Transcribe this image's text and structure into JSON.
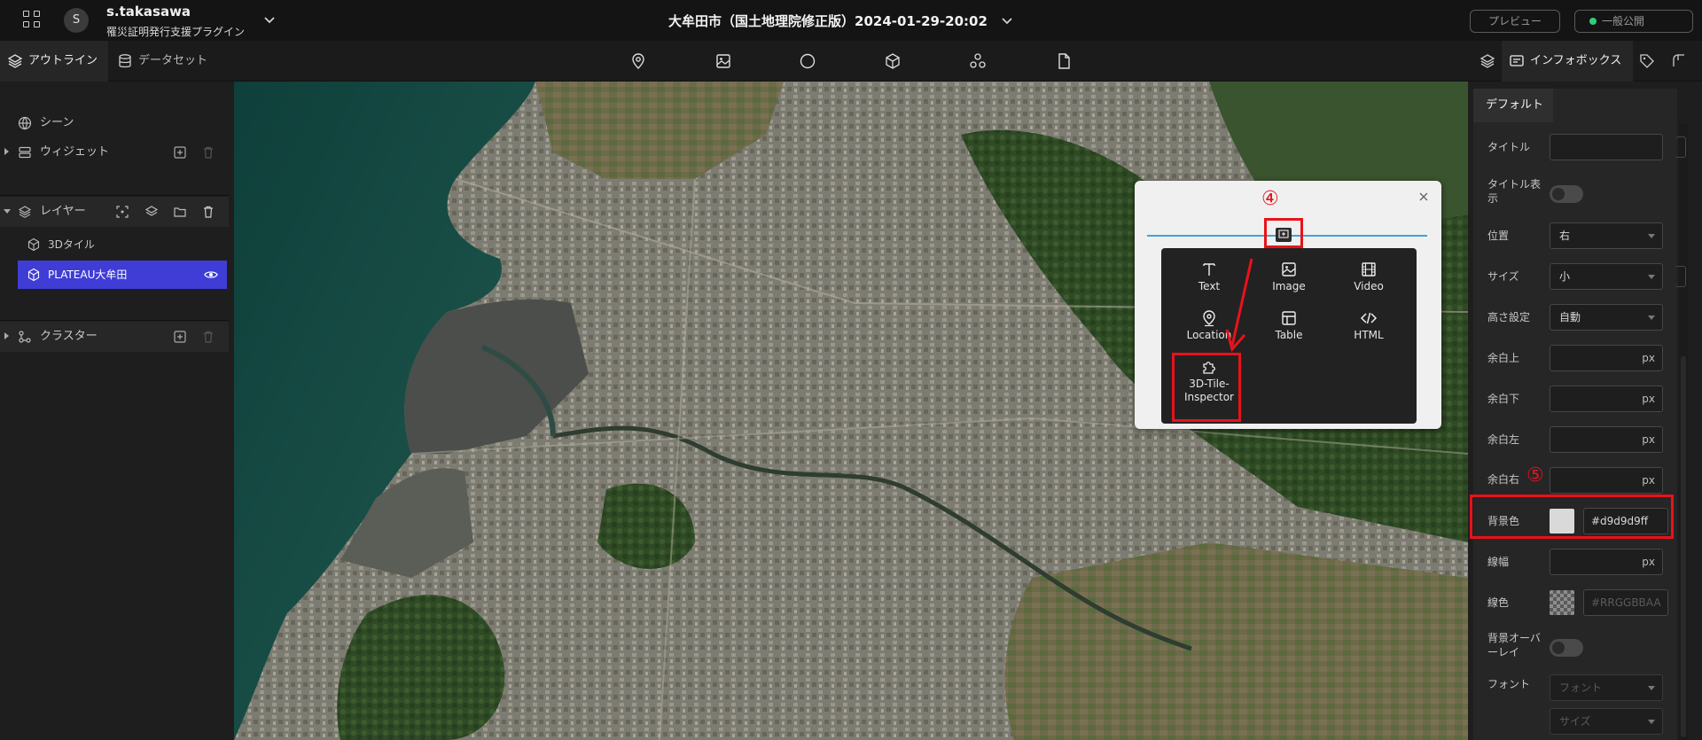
{
  "header": {
    "avatar_initial": "S",
    "user_name": "s.takasawa",
    "project_name": "罹災証明発行支援プラグイン",
    "scene_title": "大牟田市（国土地理院修正版）2024-01-29-20:02",
    "preview_label": "プレビュー",
    "publish_label": "一般公開",
    "publish_status_color": "#2fcf79"
  },
  "left_tabs": [
    {
      "label": "アウトライン",
      "icon": "layers-icon"
    },
    {
      "label": "データセット",
      "icon": "database-icon"
    }
  ],
  "toolbar_icons": [
    "location-pin-icon",
    "image-icon",
    "circle-icon",
    "box-icon",
    "cluster-icon",
    "file-icon"
  ],
  "right_tabs": {
    "info_label": "インフォボックス",
    "icons": [
      "layers-icon",
      "infobox-icon",
      "tag-icon",
      "feature-icon"
    ]
  },
  "outline": {
    "scene": "シーン",
    "widgets": "ウィジェット",
    "layers": "レイヤー",
    "layer_items": [
      "3Dタイル",
      "PLATEAU大牟田"
    ],
    "cluster": "クラスター"
  },
  "popup": {
    "annotation": "④",
    "blocks": [
      {
        "label": "Text",
        "icon": "text-icon"
      },
      {
        "label": "Image",
        "icon": "image-icon"
      },
      {
        "label": "Video",
        "icon": "video-icon"
      },
      {
        "label": "Location",
        "icon": "location-pin-icon"
      },
      {
        "label": "Table",
        "icon": "table-icon"
      },
      {
        "label": "HTML",
        "icon": "code-icon"
      },
      {
        "label": "3D-Tile-\nInspector",
        "icon": "puzzle-icon"
      }
    ]
  },
  "infobox": {
    "tab": "デフォルト",
    "annotation": "⑤",
    "props": {
      "title": {
        "label": "タイトル",
        "value": ""
      },
      "title_show": {
        "label": "タイトル表示",
        "on": false
      },
      "position": {
        "label": "位置",
        "value": "右"
      },
      "size": {
        "label": "サイズ",
        "value": "小"
      },
      "height": {
        "label": "高さ設定",
        "value": "自動"
      },
      "pad_top": {
        "label": "余白上",
        "unit": "px"
      },
      "pad_bottom": {
        "label": "余白下",
        "unit": "px"
      },
      "pad_left": {
        "label": "余白左",
        "unit": "px"
      },
      "pad_right": {
        "label": "余白右",
        "unit": "px"
      },
      "bg_color": {
        "label": "背景色",
        "value": "#d9d9d9ff",
        "swatch": "#d9d9d9"
      },
      "border_width": {
        "label": "線幅",
        "unit": "px"
      },
      "border_color": {
        "label": "線色",
        "placeholder": "#RRGGBBAA"
      },
      "bg_overlay": {
        "label": "背景オーバーレイ",
        "on": false
      },
      "font": {
        "label": "フォント",
        "family_placeholder": "フォント",
        "size_placeholder": "サイズ"
      }
    }
  },
  "colors": {
    "accent": "#3f3dd6",
    "annotation": "#e8121b",
    "popup_line": "#3aa5d8"
  }
}
